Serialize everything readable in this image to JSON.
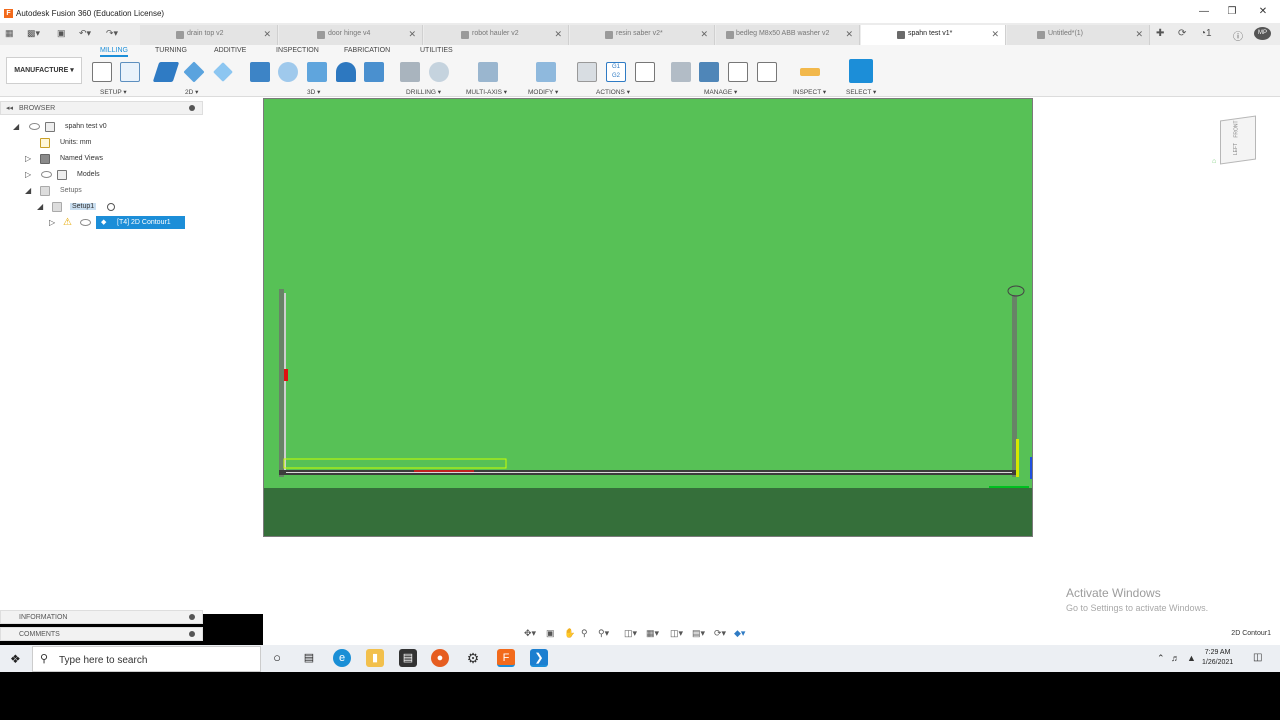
{
  "window": {
    "title": "Autodesk Fusion 360 (Education License)",
    "app_icon": "F"
  },
  "doc_tabs": [
    {
      "label": "drain top v2",
      "active": false
    },
    {
      "label": "door hinge v4",
      "active": false
    },
    {
      "label": "robot hauler v2",
      "active": false
    },
    {
      "label": "resin saber v2*",
      "active": false
    },
    {
      "label": "bedleg M8x50 ABB washer v2",
      "active": false
    },
    {
      "label": "spahn test v1*",
      "active": true
    },
    {
      "label": "Untitled*(1)",
      "active": false
    }
  ],
  "toolbar": {
    "workspace": "MANUFACTURE ▾",
    "tabs": [
      "MILLING",
      "TURNING",
      "ADDITIVE",
      "INSPECTION",
      "FABRICATION",
      "UTILITIES"
    ],
    "groups": [
      "SETUP ▾",
      "2D ▾",
      "3D ▾",
      "DRILLING ▾",
      "MULTI-AXIS ▾",
      "MODIFY ▾",
      "ACTIONS ▾",
      "MANAGE ▾",
      "INSPECT ▾",
      "SELECT ▾"
    ]
  },
  "browser": {
    "header": "BROWSER",
    "root": "spahn test v0",
    "units": "Units: mm",
    "named_views": "Named Views",
    "models": "Models",
    "setups": "Setups",
    "setup1": "Setup1",
    "operation": "[T4] 2D Contour1"
  },
  "panels": {
    "information": "INFORMATION",
    "comments": "COMMENTS"
  },
  "viewcube": {
    "front": "FRONT",
    "left": "LEFT"
  },
  "watermark": {
    "line1": "Activate Windows",
    "line2": "Go to Settings to activate Windows."
  },
  "status": {
    "selection": "2D Contour1"
  },
  "taskbar": {
    "search_placeholder": "Type here to search",
    "time": "7:29 AM",
    "date": "1/26/2021"
  },
  "colors": {
    "stock_top": "#57c156",
    "stock_side": "#356f3a",
    "accent": "#1c8ed8",
    "toolpath": "#c8ff00"
  }
}
